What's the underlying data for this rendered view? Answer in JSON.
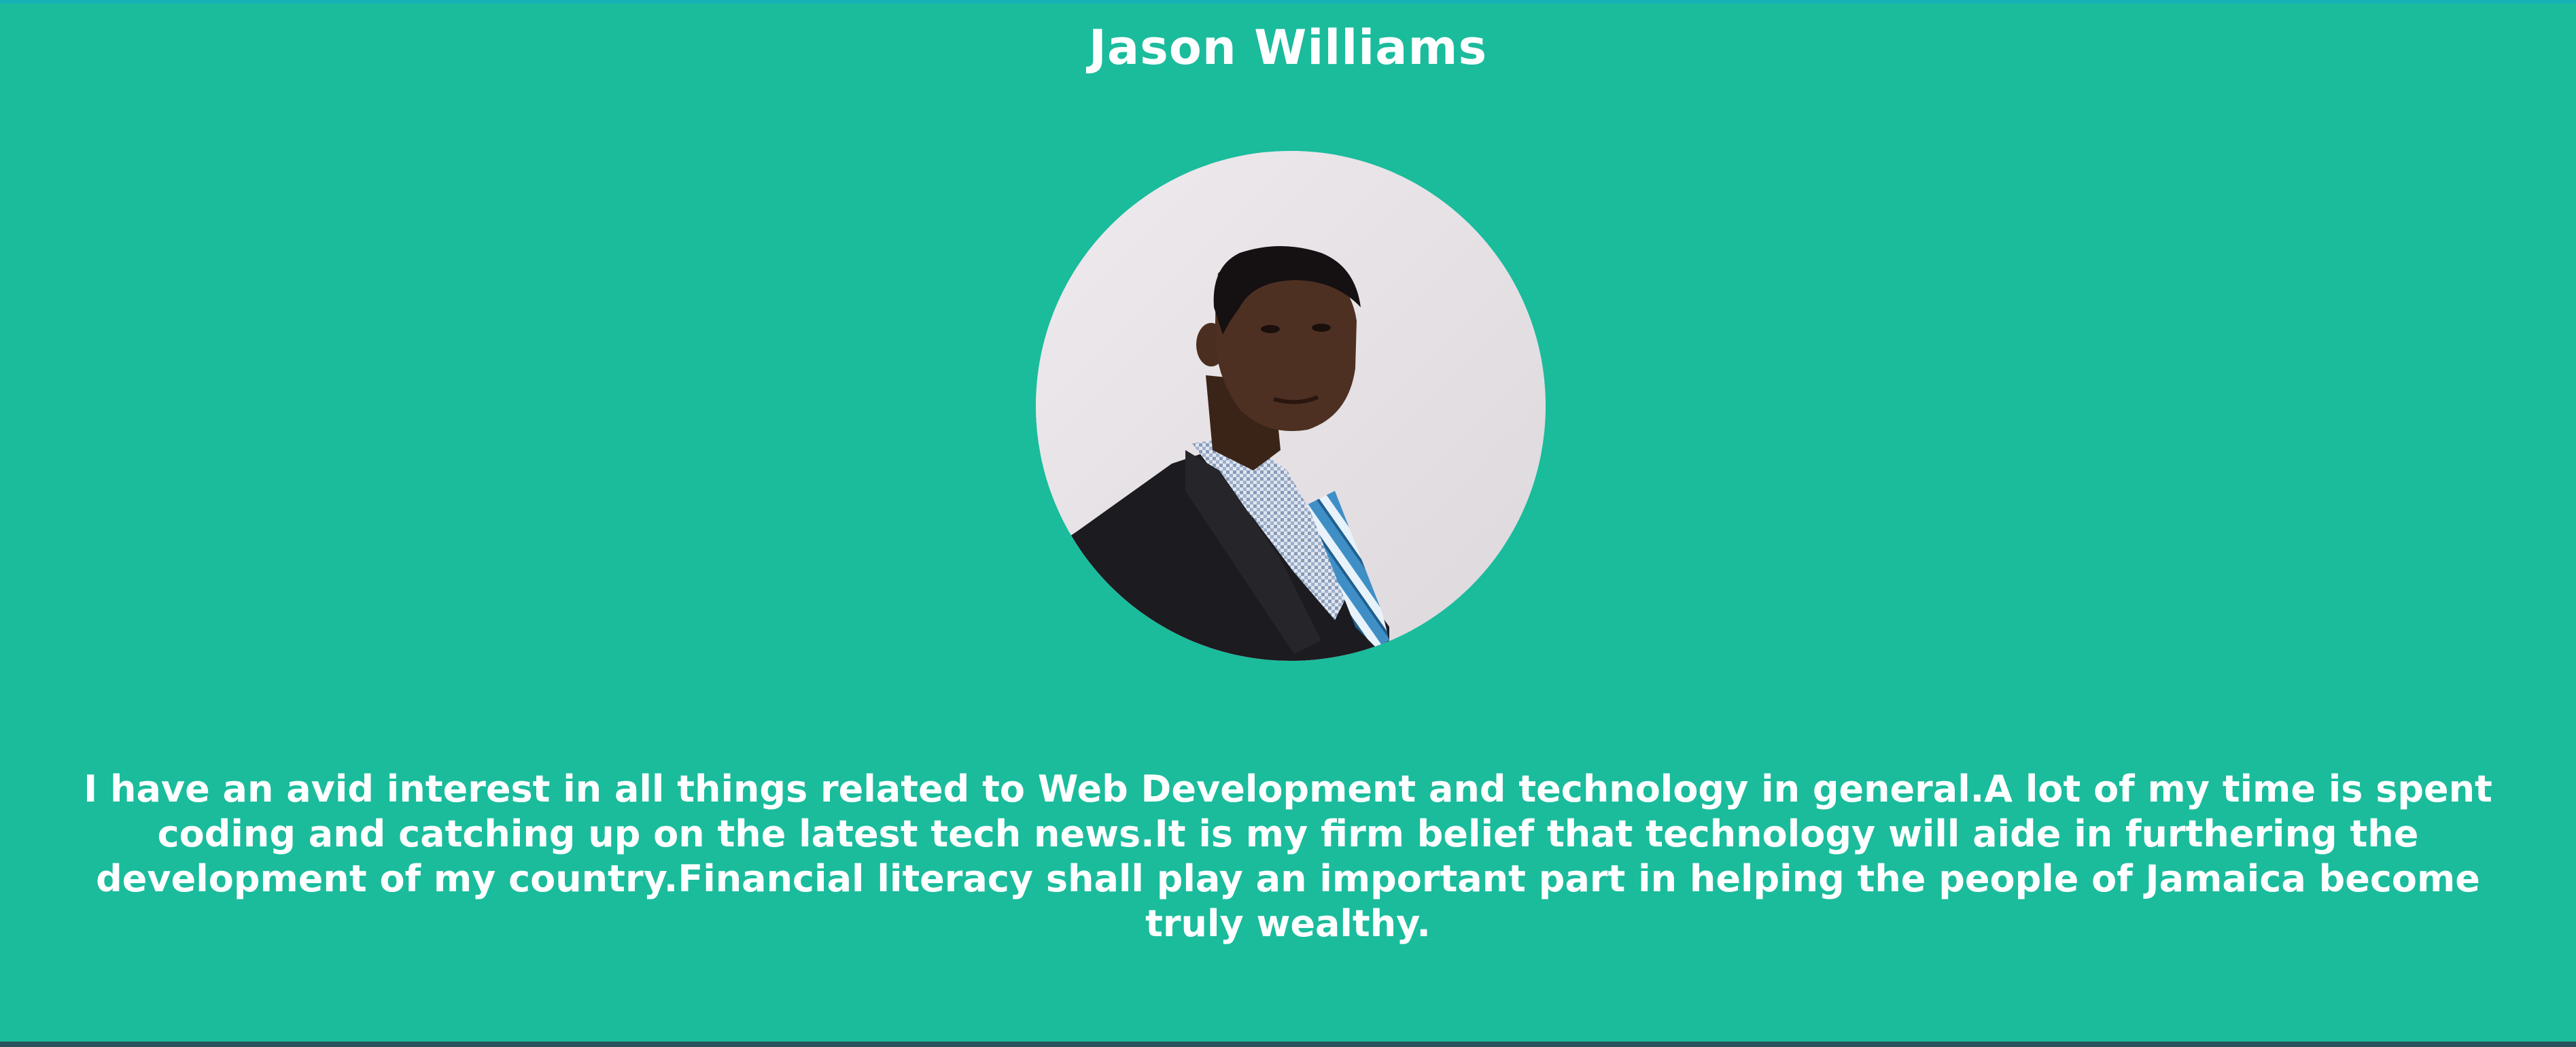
{
  "profile": {
    "name": "Jason Williams",
    "avatar_alt": "Jason Williams",
    "bio": "I have an avid interest in all things related to Web Development and technology in general.A lot of my time is spent coding and catching up on the latest tech news.It is my firm belief that technology will aide in furthering the development of my country.Financial literacy shall play an important part in helping the people of Jamaica become truly wealthy."
  },
  "colors": {
    "background": "#1abc9c",
    "text": "#ffffff",
    "top_border": "#17b0b8",
    "bottom_border": "#2c3e50"
  }
}
